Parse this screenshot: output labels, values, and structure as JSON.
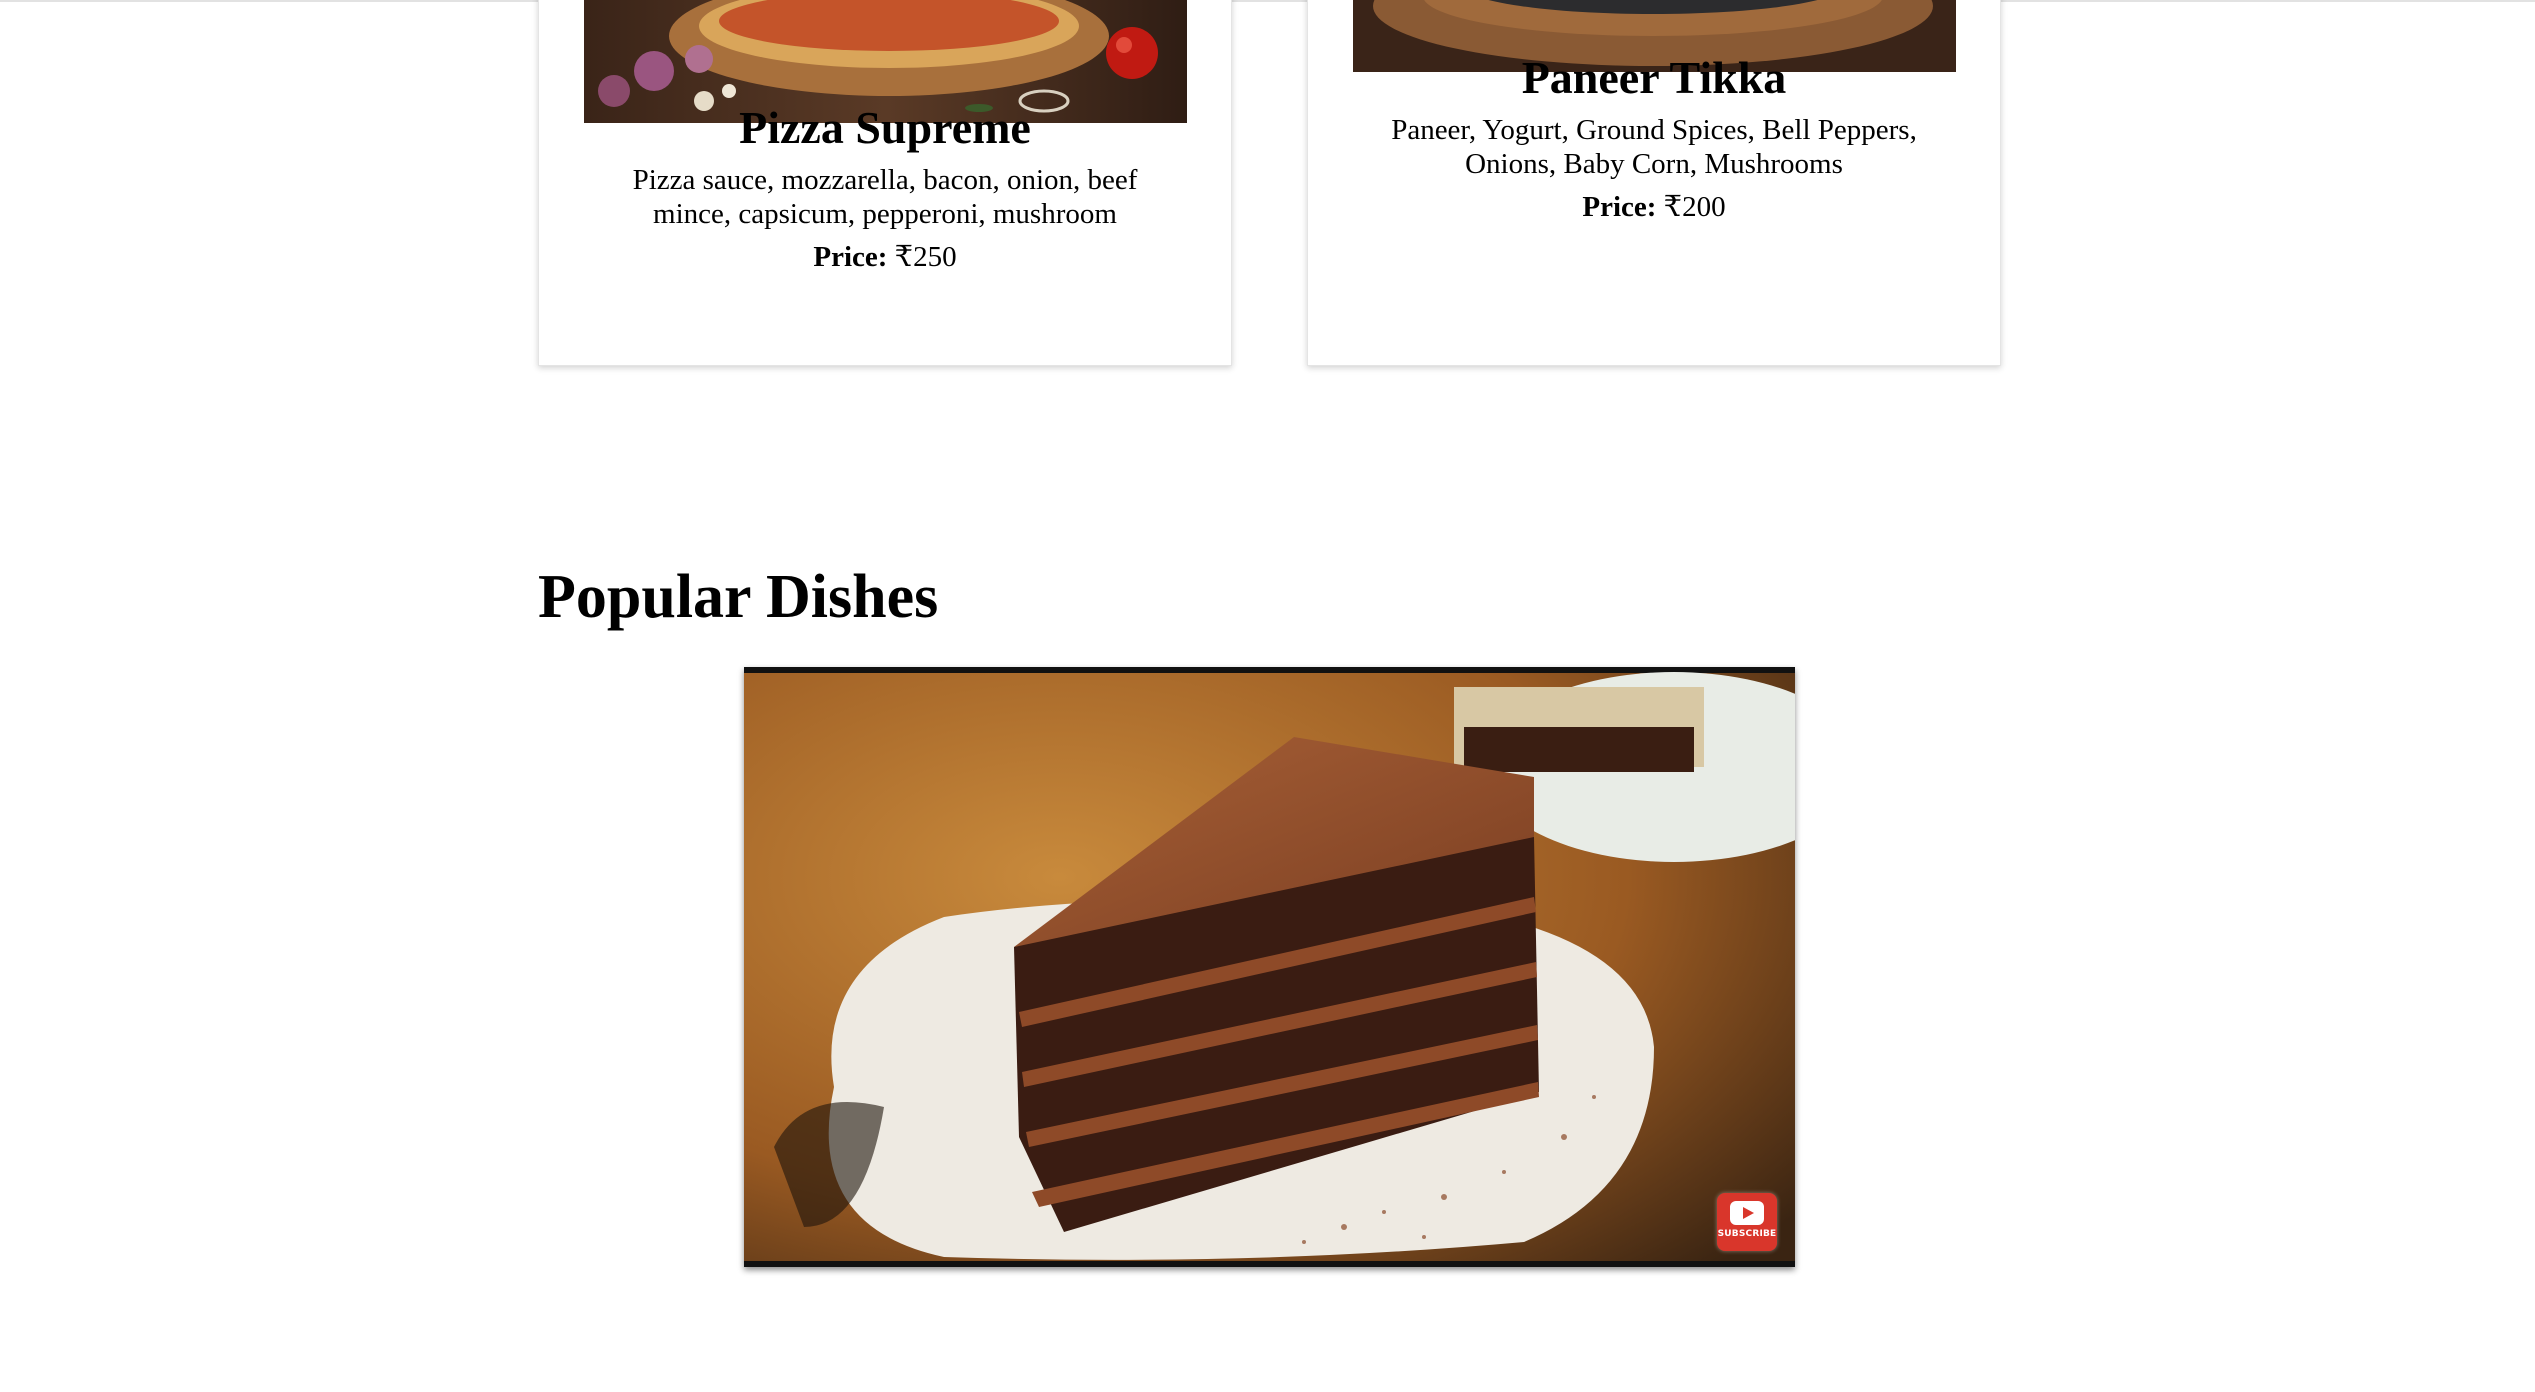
{
  "menu_cards": [
    {
      "name": "Pizza Supreme",
      "description": "Pizza sauce, mozzarella, bacon, onion, beef mince, capsicum, pepperoni, mushroom",
      "price_label": "Price:",
      "price_value": "₹250"
    },
    {
      "name": "Paneer Tikka",
      "description": "Paneer, Yogurt, Ground Spices, Bell Peppers, Onions, Baby Corn, Mushrooms",
      "price_label": "Price:",
      "price_value": "₹200"
    }
  ],
  "popular": {
    "heading": "Popular Dishes",
    "video": {
      "subscribe_label": "SUBSCRIBE"
    }
  },
  "colors": {
    "subscribe_red": "#d9362b",
    "card_border": "#e4e4e4"
  }
}
